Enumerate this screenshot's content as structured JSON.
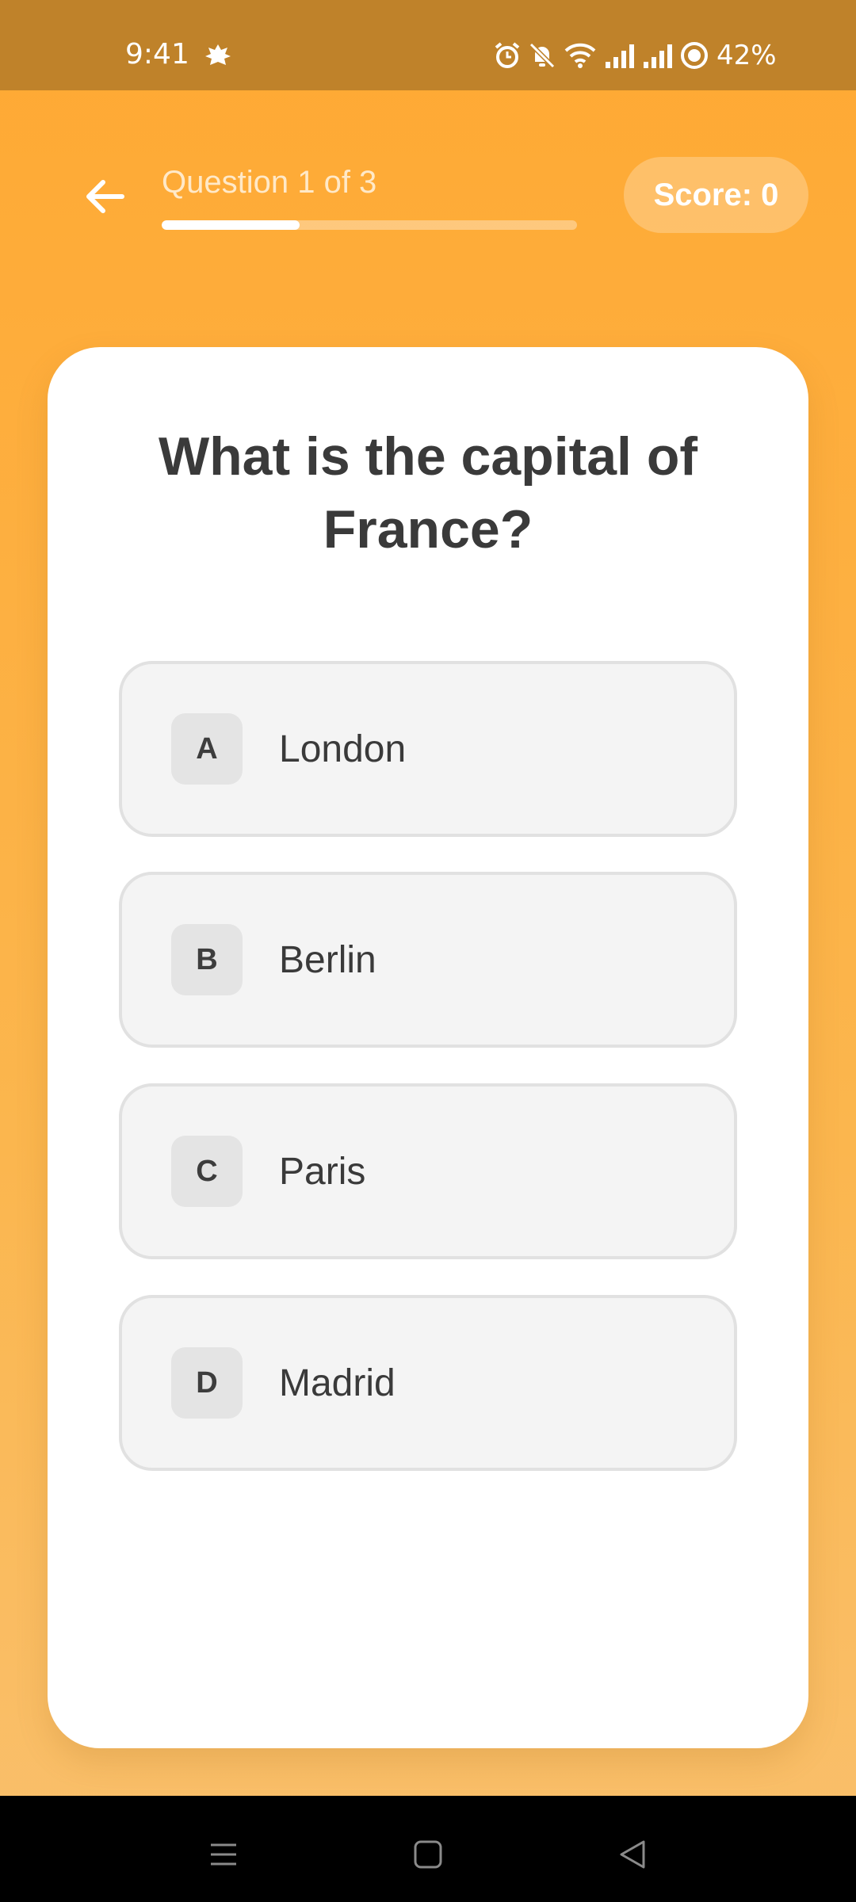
{
  "status_bar": {
    "time": "9:41",
    "battery": "42%",
    "icons": [
      "notification-leaf-icon",
      "alarm-icon",
      "bell-off-icon",
      "wifi-icon",
      "signal-icon",
      "signal-icon",
      "battery-saver-icon"
    ]
  },
  "header": {
    "back_icon": "arrow-left-icon",
    "progress_label": "Question 1 of 3",
    "progress_fraction": 0.333,
    "score": "Score: 0"
  },
  "question": {
    "text": "What is the capital of France?"
  },
  "options": [
    {
      "letter": "A",
      "text": "London"
    },
    {
      "letter": "B",
      "text": "Berlin"
    },
    {
      "letter": "C",
      "text": "Paris"
    },
    {
      "letter": "D",
      "text": "Madrid"
    }
  ],
  "nav_bar": {
    "icons": [
      "menu-icon",
      "home-icon",
      "back-triangle-icon"
    ]
  },
  "colors": {
    "background_top": "#FFA933",
    "background_bottom": "#F9C06D",
    "status_bar": "#BF822A",
    "card": "#FFFFFF",
    "option_bg": "#F4F4F4",
    "option_border": "#E1E1E1"
  }
}
